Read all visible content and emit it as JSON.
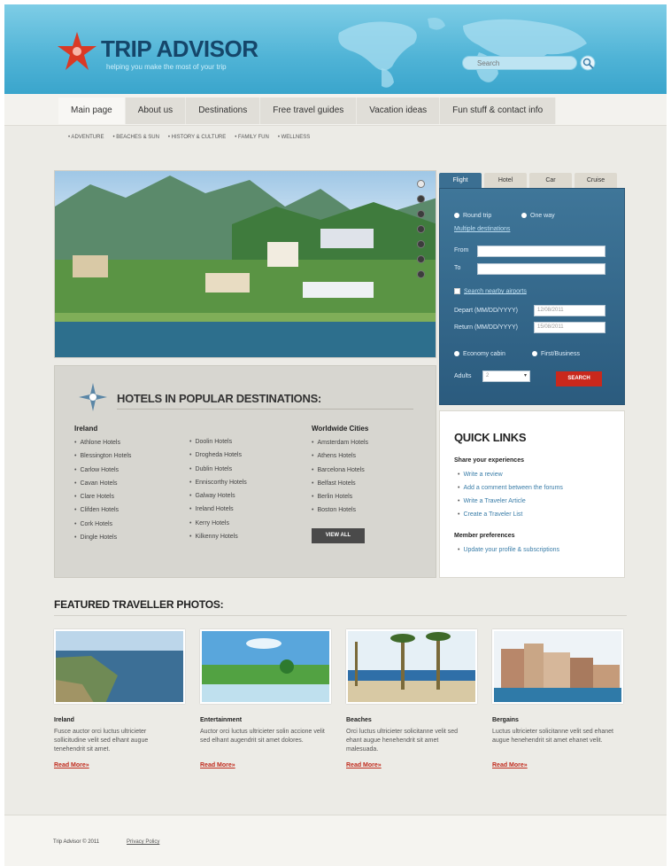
{
  "header": {
    "logo_title": "TRIP ADVISOR",
    "logo_tagline": "helping you make the most of your trip",
    "search_placeholder": "Search",
    "brand_color": "#15466a",
    "header_color": "#4fb3d6"
  },
  "nav": {
    "tabs": [
      "Main page",
      "About us",
      "Destinations",
      "Free travel guides",
      "Vacation ideas",
      "Fun stuff & contact info"
    ],
    "active": "Main page",
    "subnav": [
      "• ADVENTURE",
      "• BEACHES & SUN",
      "• HISTORY & CULTURE",
      "• FAMILY FUN",
      "• WELLNESS"
    ]
  },
  "slider": {
    "dot_count": 7,
    "active_dot": 1
  },
  "hotels": {
    "title": "HOTELS IN POPULAR DESTINATIONS:",
    "columns": [
      {
        "heading": "Ireland",
        "items": [
          "Athlone Hotels",
          "Blessington Hotels",
          "Carlow Hotels",
          "Cavan Hotels",
          "Clare Hotels",
          "Clifden Hotels",
          "Cork Hotels",
          "Dingle Hotels"
        ]
      },
      {
        "heading": "",
        "items": [
          "Doolin Hotels",
          "Drogheda Hotels",
          "Dublin Hotels",
          "Enniscorthy Hotels",
          "Galway Hotels",
          "Ireland Hotels",
          "Kerry Hotels",
          "Kilkenny Hotels"
        ]
      },
      {
        "heading": "Worldwide Cities",
        "items": [
          "Amsterdam Hotels",
          "Athens Hotels",
          "Barcelona Hotels",
          "Belfast Hotels",
          "Berlin Hotels",
          "Boston Hotels"
        ]
      }
    ],
    "view_all": "VIEW ALL"
  },
  "booking": {
    "tabs": [
      "Flight",
      "Hotel",
      "Car",
      "Cruise"
    ],
    "active_tab": "Flight",
    "round_trip": "Round trip",
    "one_way": "One way",
    "multiple": "Multiple destinations",
    "from_label": "From",
    "to_label": "To",
    "nearby": "Search nearby airports",
    "depart_label": "Depart (MM/DD/YYYY)",
    "return_label": "Return (MM/DD/YYYY)",
    "depart_value": "12/08/2011",
    "return_value": "15/08/2011",
    "economy": "Economy cabin",
    "first": "First/Business",
    "adults_label": "Adults",
    "adults_value": "2",
    "search_button": "SEARCH",
    "button_color": "#c9281c"
  },
  "quick_links": {
    "title": "QUICK LINKS",
    "share_heading": "Share your experiences",
    "share_links": [
      "Write a review",
      "Add a comment between the forums",
      "Write a Traveler Article",
      "Create a Traveler List"
    ],
    "member_heading": "Member preferences",
    "member_links": [
      "Update your profile & subscriptions"
    ]
  },
  "featured": {
    "title": "FEATURED TRAVELLER PHOTOS:",
    "items": [
      {
        "title": "Ireland",
        "desc": "Fusce auctor orci luctus ultricieter sollicitudine velit sed elhant augue tenehendrit sit amet.",
        "more": "Read More»"
      },
      {
        "title": "Entertainment",
        "desc": "Auctor orci luctus ultricieter solin accione velit sed elhant augendrit sit amet dolores.",
        "more": "Read More»"
      },
      {
        "title": "Beaches",
        "desc": "Orci luctus ultricieter solicitanne velit sed ehant augue henehendrit sit amet malesuada.",
        "more": "Read More»"
      },
      {
        "title": "Bergains",
        "desc": "Luctus ultricieter solicitanne velit sed ehanet augue henehendrit sit amet ehanet velit.",
        "more": "Read More»"
      }
    ]
  },
  "footer": {
    "copyright": "Trip Advisor © 2011",
    "privacy": "Privacy Policy"
  }
}
